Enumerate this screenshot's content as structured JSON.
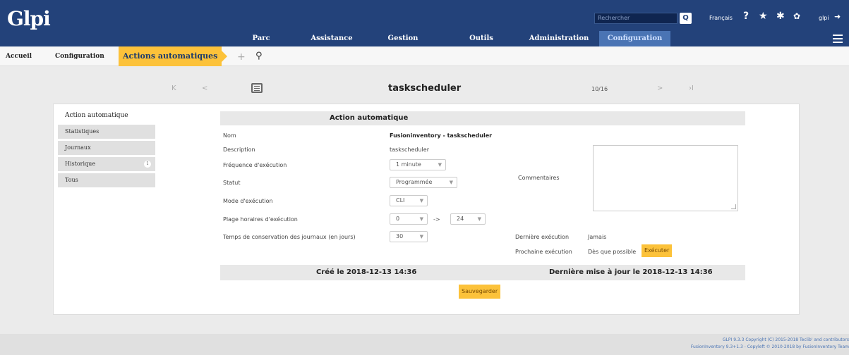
{
  "app": {
    "logo": "Glpi"
  },
  "header": {
    "search_placeholder": "Rechercher",
    "language": "Français",
    "user": "glpi",
    "menu": [
      "Parc",
      "Assistance",
      "Gestion",
      "Outils",
      "Administration",
      "Configuration"
    ],
    "active_menu": "Configuration"
  },
  "breadcrumb": {
    "items": [
      "Accueil",
      "Configuration",
      "Actions automatiques"
    ]
  },
  "record_nav": {
    "title": "taskscheduler",
    "position": "10/16",
    "first": "K",
    "prev": "<",
    "next": ">",
    "last": "›I"
  },
  "tabs": [
    {
      "label": "Action automatique",
      "active": true
    },
    {
      "label": "Statistiques"
    },
    {
      "label": "Journaux"
    },
    {
      "label": "Historique",
      "badge": "1"
    },
    {
      "label": "Tous"
    }
  ],
  "form": {
    "header": "Action automatique",
    "name_label": "Nom",
    "name_value": "Fusioninventory - taskscheduler",
    "description_label": "Description",
    "description_value": "taskscheduler",
    "frequency_label": "Fréquence d'exécution",
    "frequency_value": "1 minute",
    "status_label": "Statut",
    "status_value": "Programmée",
    "mode_label": "Mode d'exécution",
    "mode_value": "CLI",
    "range_label": "Plage horaires d'exécution",
    "range_start": "0",
    "range_arrow": "->",
    "range_end": "24",
    "retention_label": "Temps de conservation des journaux (en jours)",
    "retention_value": "30",
    "comments_label": "Commentaires",
    "last_run_label": "Dernière exécution",
    "last_run_value": "Jamais",
    "next_run_label": "Prochaine exécution",
    "next_run_value": "Dès que possible",
    "execute_button": "Exécuter",
    "created": "Créé le 2018-12-13 14:36",
    "updated": "Dernière mise à jour le 2018-12-13 14:36",
    "save_button": "Sauvegarder"
  },
  "footer": {
    "line1": "GLPI 9.3.3 Copyright (C) 2015-2018 Teclib' and contributors",
    "line2": "FusionInventory 9.3+1.3 - Copyleft © 2010-2018 by FusionInventory Team"
  }
}
